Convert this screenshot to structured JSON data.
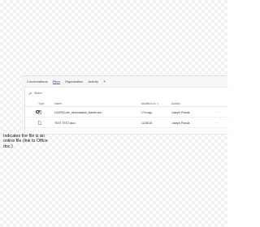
{
  "tabs": [
    {
      "label": "Conversations",
      "active": false
    },
    {
      "label": "Files",
      "active": true
    },
    {
      "label": "Organization",
      "active": false
    },
    {
      "label": "Activity",
      "active": false
    }
  ],
  "add_tab_symbol": "+",
  "toolbar": {
    "share_label": "Share",
    "share_icon": "share-icon"
  },
  "table": {
    "headers": {
      "type": "Type",
      "name": "Name",
      "modified": "Modified on",
      "activity": "Activity"
    },
    "rows": [
      {
        "name": "UX4P5Code_Informatable_Master.doc",
        "modified": "17m ago",
        "activity": "Joseph Pineda",
        "icon": "word-doc-icon",
        "online": true
      },
      {
        "name": "TEST TEST.docx",
        "modified": "11/28/18",
        "activity": "Joseph Pineda",
        "icon": "document-icon",
        "online": false
      }
    ],
    "more_symbol": "···"
  },
  "annotation": "Indicates the file is an online file (link to Office doc.)",
  "colors": {
    "accent": "#5b5fc7",
    "panel_bg": "#f6f6f6"
  }
}
